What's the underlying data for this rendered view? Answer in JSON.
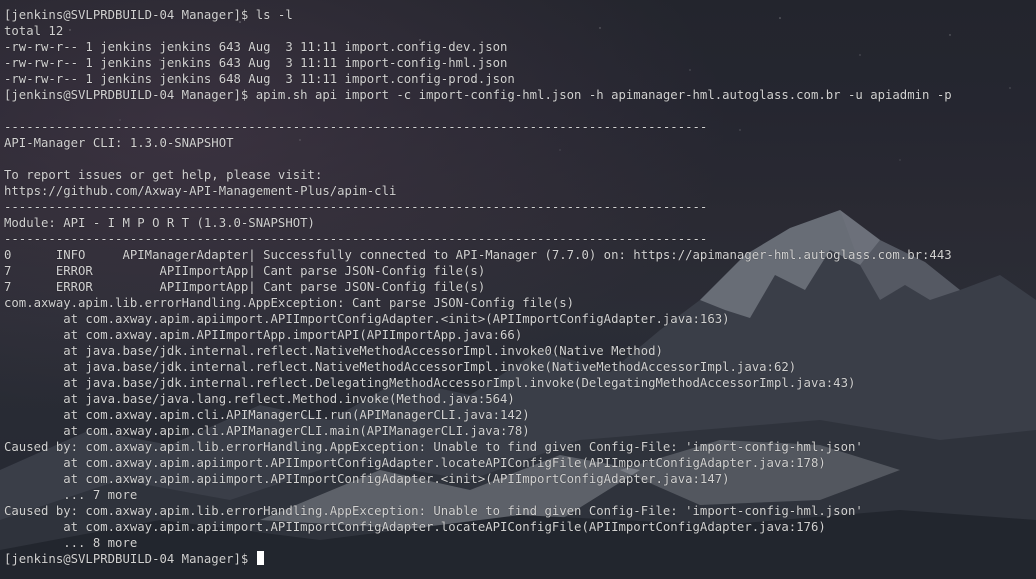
{
  "terminal": {
    "lines": [
      "[jenkins@SVLPRDBUILD-04 Manager]$ ls -l",
      "total 12",
      "-rw-rw-r-- 1 jenkins jenkins 643 Aug  3 11:11 import.config-dev.json",
      "-rw-rw-r-- 1 jenkins jenkins 643 Aug  3 11:11 import-config-hml.json",
      "-rw-rw-r-- 1 jenkins jenkins 648 Aug  3 11:11 import.config-prod.json",
      "[jenkins@SVLPRDBUILD-04 Manager]$ apim.sh api import -c import-config-hml.json -h apimanager-hml.autoglass.com.br -u apiadmin -p",
      "",
      "-----------------------------------------------------------------------------------------------",
      "API-Manager CLI: 1.3.0-SNAPSHOT",
      "",
      "To report issues or get help, please visit:",
      "https://github.com/Axway-API-Management-Plus/apim-cli",
      "-----------------------------------------------------------------------------------------------",
      "Module: API - I M P O R T (1.3.0-SNAPSHOT)",
      "-----------------------------------------------------------------------------------------------",
      "0      INFO     APIManagerAdapter| Successfully connected to API-Manager (7.7.0) on: https://apimanager-hml.autoglass.com.br:443",
      "7      ERROR         APIImportApp| Cant parse JSON-Config file(s)",
      "7      ERROR         APIImportApp| Cant parse JSON-Config file(s)",
      "com.axway.apim.lib.errorHandling.AppException: Cant parse JSON-Config file(s)",
      "        at com.axway.apim.apiimport.APIImportConfigAdapter.<init>(APIImportConfigAdapter.java:163)",
      "        at com.axway.apim.APIImportApp.importAPI(APIImportApp.java:66)",
      "        at java.base/jdk.internal.reflect.NativeMethodAccessorImpl.invoke0(Native Method)",
      "        at java.base/jdk.internal.reflect.NativeMethodAccessorImpl.invoke(NativeMethodAccessorImpl.java:62)",
      "        at java.base/jdk.internal.reflect.DelegatingMethodAccessorImpl.invoke(DelegatingMethodAccessorImpl.java:43)",
      "        at java.base/java.lang.reflect.Method.invoke(Method.java:564)",
      "        at com.axway.apim.cli.APIManagerCLI.run(APIManagerCLI.java:142)",
      "        at com.axway.apim.cli.APIManagerCLI.main(APIManagerCLI.java:78)",
      "Caused by: com.axway.apim.lib.errorHandling.AppException: Unable to find given Config-File: 'import-config-hml.json'",
      "        at com.axway.apim.apiimport.APIImportConfigAdapter.locateAPIConfigFile(APIImportConfigAdapter.java:178)",
      "        at com.axway.apim.apiimport.APIImportConfigAdapter.<init>(APIImportConfigAdapter.java:147)",
      "        ... 7 more",
      "Caused by: com.axway.apim.lib.errorHandling.AppException: Unable to find given Config-File: 'import-config-hml.json'",
      "        at com.axway.apim.apiimport.APIImportConfigAdapter.locateAPIConfigFile(APIImportConfigAdapter.java:176)",
      "        ... 8 more"
    ],
    "final_prompt": "[jenkins@SVLPRDBUILD-04 Manager]$ "
  }
}
